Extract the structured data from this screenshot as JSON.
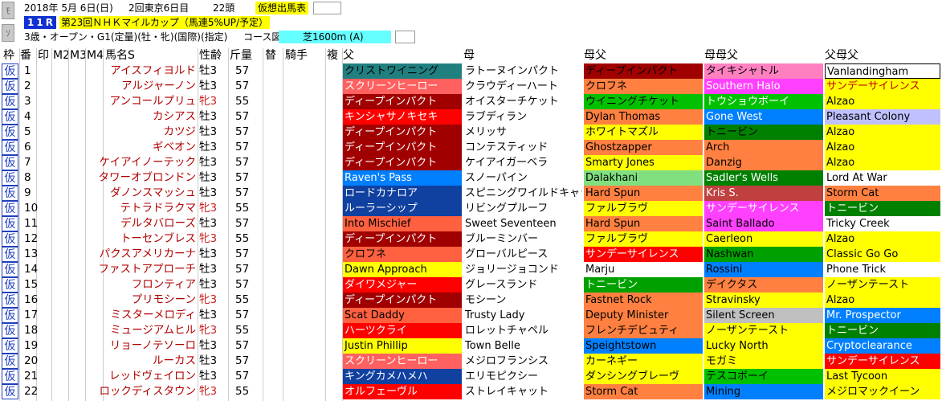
{
  "header": {
    "date": "2018年 5月 6日(日)",
    "meeting": "2回東京6日目",
    "count": "22頭",
    "card_type": "仮想出馬表",
    "race_no": "11R",
    "race_name": "第23回ＮＨＫマイルカップ（馬連5%UP/予定）",
    "conditions": "3歳・オープン・G1(定量)(牡・牝)(国際)(指定)",
    "course_label": "コース図",
    "course": "芝1600m (A)",
    "nav_up": "ﾓ",
    "nav_down": "ｿ"
  },
  "columns": [
    "枠",
    "番",
    "印",
    "M2",
    "M3",
    "M4",
    "馬名S",
    "性齢",
    "斤量",
    "替",
    "騎手",
    "複",
    "父",
    "母",
    "母父",
    "母母父",
    "父母父"
  ],
  "colors": {
    "accent": "#1030d0",
    "highlight": "#ffff00",
    "course": "#66ffff",
    "female": "#cc2020"
  },
  "rows": [
    {
      "waku": "仮",
      "num": "1",
      "name": "アイスフィヨルド",
      "sex": "牡3",
      "wt": "57",
      "sire": "クリストワイニング",
      "dam": "ラトーヌインパクト",
      "damsire": "ディープインパクト",
      "dd_sire": "タイキシャトル",
      "sire_sire": "Vanlandingham",
      "c": [
        "#208080",
        "#fff",
        "#a00000",
        "#ff80c0",
        "#fff"
      ],
      "t": [
        "#000",
        "#000",
        "#000",
        "#000",
        "#000"
      ]
    },
    {
      "waku": "仮",
      "num": "2",
      "name": "アルジャーノン",
      "sex": "牡3",
      "wt": "57",
      "sire": "スクリーンヒーロー",
      "dam": "クラウディーハート",
      "damsire": "クロフネ",
      "dd_sire": "Southern Halo",
      "sire_sire": "サンデーサイレンス",
      "c": [
        "#ff6060",
        "#fff",
        "#ff8040",
        "#ff40ff",
        "#ffff00"
      ],
      "t": [
        "#fff",
        "#000",
        "#000",
        "#fff",
        "#c00000"
      ]
    },
    {
      "waku": "仮",
      "num": "3",
      "name": "アンコールプリュ",
      "sex": "牝3",
      "wt": "55",
      "sire": "ディープインパクト",
      "dam": "オイスターチケット",
      "damsire": "ウイニングチケット",
      "dd_sire": "トウショウボーイ",
      "sire_sire": "Alzao",
      "c": [
        "#a00000",
        "#fff",
        "#00c000",
        "#00c000",
        "#ffff00"
      ],
      "t": [
        "#fff",
        "#000",
        "#000",
        "#fff",
        "#000"
      ]
    },
    {
      "waku": "仮",
      "num": "4",
      "name": "カシアス",
      "sex": "牡3",
      "wt": "57",
      "sire": "キンシャサノキセキ",
      "dam": "ラブディラン",
      "damsire": "Dylan Thomas",
      "dd_sire": "Gone West",
      "sire_sire": "Pleasant Colony",
      "c": [
        "#ff0000",
        "#fff",
        "#ff8040",
        "#0080ff",
        "#c0c0ff"
      ],
      "t": [
        "#fff",
        "#000",
        "#000",
        "#fff",
        "#000"
      ]
    },
    {
      "waku": "仮",
      "num": "5",
      "name": "カツジ",
      "sex": "牡3",
      "wt": "57",
      "sire": "ディープインパクト",
      "dam": "メリッサ",
      "damsire": "ホワイトマズル",
      "dd_sire": "トニービン",
      "sire_sire": "Alzao",
      "c": [
        "#a00000",
        "#fff",
        "#ffff00",
        "#008000",
        "#ffff00"
      ],
      "t": [
        "#fff",
        "#000",
        "#000",
        "#000",
        "#000"
      ]
    },
    {
      "waku": "仮",
      "num": "6",
      "name": "ギベオン",
      "sex": "牡3",
      "wt": "57",
      "sire": "ディープインパクト",
      "dam": "コンテスティッド",
      "damsire": "Ghostzapper",
      "dd_sire": "Arch",
      "sire_sire": "Alzao",
      "c": [
        "#a00000",
        "#fff",
        "#ff8040",
        "#ff8040",
        "#ffff00"
      ],
      "t": [
        "#fff",
        "#000",
        "#000",
        "#000",
        "#000"
      ]
    },
    {
      "waku": "仮",
      "num": "7",
      "name": "ケイアイノーテック",
      "sex": "牡3",
      "wt": "57",
      "sire": "ディープインパクト",
      "dam": "ケイアイガーベラ",
      "damsire": "Smarty Jones",
      "dd_sire": "Danzig",
      "sire_sire": "Alzao",
      "c": [
        "#a00000",
        "#fff",
        "#ffff00",
        "#ff8040",
        "#ffff00"
      ],
      "t": [
        "#fff",
        "#000",
        "#000",
        "#000",
        "#000"
      ]
    },
    {
      "waku": "仮",
      "num": "8",
      "name": "タワーオブロンドン",
      "sex": "牡3",
      "wt": "57",
      "sire": "Raven's Pass",
      "dam": "スノーパイン",
      "damsire": "Dalakhani",
      "dd_sire": "Sadler's Wells",
      "sire_sire": "Lord At War",
      "c": [
        "#0080ff",
        "#fff",
        "#80e080",
        "#008000",
        "#fff"
      ],
      "t": [
        "#fff",
        "#000",
        "#000",
        "#fff",
        "#000"
      ]
    },
    {
      "waku": "仮",
      "num": "9",
      "name": "ダノンスマッシュ",
      "sex": "牡3",
      "wt": "57",
      "sire": "ロードカナロア",
      "dam": "スピニングワイルドキャット",
      "damsire": "Hard Spun",
      "dd_sire": "Kris S.",
      "sire_sire": "Storm Cat",
      "c": [
        "#1040a0",
        "#fff",
        "#ff8040",
        "#c04040",
        "#ff8040"
      ],
      "t": [
        "#fff",
        "#000",
        "#000",
        "#fff",
        "#000"
      ]
    },
    {
      "waku": "仮",
      "num": "10",
      "name": "テトラドラクマ",
      "sex": "牝3",
      "wt": "55",
      "sire": "ルーラーシップ",
      "dam": "リビングプルーフ",
      "damsire": "ファルブラヴ",
      "dd_sire": "サンデーサイレンス",
      "sire_sire": "トニービン",
      "c": [
        "#1040a0",
        "#fff",
        "#ffff00",
        "#ff40ff",
        "#008000"
      ],
      "t": [
        "#fff",
        "#000",
        "#000",
        "#fff",
        "#fff"
      ]
    },
    {
      "waku": "仮",
      "num": "11",
      "name": "デルタバローズ",
      "sex": "牡3",
      "wt": "57",
      "sire": "Into Mischief",
      "dam": "Sweet Seventeen",
      "damsire": "Hard Spun",
      "dd_sire": "Saint Ballado",
      "sire_sire": "Tricky Creek",
      "c": [
        "#ff6040",
        "#fff",
        "#ff8040",
        "#ff40ff",
        "#fff"
      ],
      "t": [
        "#000",
        "#000",
        "#000",
        "#000",
        "#000"
      ]
    },
    {
      "waku": "仮",
      "num": "12",
      "name": "トーセンブレス",
      "sex": "牝3",
      "wt": "55",
      "sire": "ディープインパクト",
      "dam": "ブルーミンバー",
      "damsire": "ファルブラヴ",
      "dd_sire": "Caerleon",
      "sire_sire": "Alzao",
      "c": [
        "#a00000",
        "#fff",
        "#ffff00",
        "#ffff00",
        "#ffff00"
      ],
      "t": [
        "#fff",
        "#000",
        "#000",
        "#000",
        "#000"
      ]
    },
    {
      "waku": "仮",
      "num": "13",
      "name": "パクスアメリカーナ",
      "sex": "牡3",
      "wt": "57",
      "sire": "クロフネ",
      "dam": "グローバルピース",
      "damsire": "サンデーサイレンス",
      "dd_sire": "Nashwan",
      "sire_sire": "Classic Go Go",
      "c": [
        "#ff6040",
        "#fff",
        "#ff0000",
        "#00a000",
        "#ffff00"
      ],
      "t": [
        "#000",
        "#000",
        "#fff",
        "#000",
        "#000"
      ]
    },
    {
      "waku": "仮",
      "num": "14",
      "name": "ファストアプローチ",
      "sex": "牡3",
      "wt": "57",
      "sire": "Dawn Approach",
      "dam": "ジョリージョコンド",
      "damsire": "Marju",
      "dd_sire": "Rossini",
      "sire_sire": "Phone Trick",
      "c": [
        "#ffff00",
        "#fff",
        "#fff",
        "#0080ff",
        "#fff"
      ],
      "t": [
        "#000",
        "#000",
        "#000",
        "#000",
        "#000"
      ]
    },
    {
      "waku": "仮",
      "num": "15",
      "name": "フロンティア",
      "sex": "牡3",
      "wt": "57",
      "sire": "ダイワメジャー",
      "dam": "グレースランド",
      "damsire": "トニービン",
      "dd_sire": "デイクタス",
      "sire_sire": "ノーザンテースト",
      "c": [
        "#ff0000",
        "#fff",
        "#00a000",
        "#ff8040",
        "#ffff00"
      ],
      "t": [
        "#fff",
        "#000",
        "#fff",
        "#000",
        "#000"
      ]
    },
    {
      "waku": "仮",
      "num": "16",
      "name": "プリモシーン",
      "sex": "牝3",
      "wt": "55",
      "sire": "ディープインパクト",
      "dam": "モシーン",
      "damsire": "Fastnet Rock",
      "dd_sire": "Stravinsky",
      "sire_sire": "Alzao",
      "c": [
        "#a00000",
        "#fff",
        "#ff8040",
        "#ffff00",
        "#ffff00"
      ],
      "t": [
        "#fff",
        "#000",
        "#000",
        "#000",
        "#000"
      ]
    },
    {
      "waku": "仮",
      "num": "17",
      "name": "ミスターメロディ",
      "sex": "牡3",
      "wt": "57",
      "sire": "Scat Daddy",
      "dam": "Trusty Lady",
      "damsire": "Deputy Minister",
      "dd_sire": "Silent Screen",
      "sire_sire": "Mr. Prospector",
      "c": [
        "#ff6040",
        "#fff",
        "#ff8040",
        "#c0c0c0",
        "#0080ff"
      ],
      "t": [
        "#000",
        "#000",
        "#000",
        "#000",
        "#fff"
      ]
    },
    {
      "waku": "仮",
      "num": "18",
      "name": "ミュージアムヒル",
      "sex": "牝3",
      "wt": "55",
      "sire": "ハーツクライ",
      "dam": "ロレットチャペル",
      "damsire": "フレンチデピュティ",
      "dd_sire": "ノーザンテースト",
      "sire_sire": "トニービン",
      "c": [
        "#ff0000",
        "#fff",
        "#ff8040",
        "#ffff00",
        "#008000"
      ],
      "t": [
        "#fff",
        "#000",
        "#000",
        "#000",
        "#fff"
      ]
    },
    {
      "waku": "仮",
      "num": "19",
      "name": "リョーノテソーロ",
      "sex": "牡3",
      "wt": "57",
      "sire": "Justin Phillip",
      "dam": "Town Belle",
      "damsire": "Speightstown",
      "dd_sire": "Lucky North",
      "sire_sire": "Cryptoclearance",
      "c": [
        "#ffff00",
        "#fff",
        "#0080ff",
        "#ffff00",
        "#0080ff"
      ],
      "t": [
        "#000",
        "#000",
        "#000",
        "#000",
        "#fff"
      ]
    },
    {
      "waku": "仮",
      "num": "20",
      "name": "ルーカス",
      "sex": "牡3",
      "wt": "57",
      "sire": "スクリーンヒーロー",
      "dam": "メジロフランシス",
      "damsire": "カーネギー",
      "dd_sire": "モガミ",
      "sire_sire": "サンデーサイレンス",
      "c": [
        "#ff6060",
        "#fff",
        "#ffff00",
        "#ffff00",
        "#ff0000"
      ],
      "t": [
        "#fff",
        "#000",
        "#000",
        "#000",
        "#fff"
      ]
    },
    {
      "waku": "仮",
      "num": "21",
      "name": "レッドヴェイロン",
      "sex": "牡3",
      "wt": "57",
      "sire": "キングカメハメハ",
      "dam": "エリモピクシー",
      "damsire": "ダンシングブレーヴ",
      "dd_sire": "テスコボーイ",
      "sire_sire": "Last Tycoon",
      "c": [
        "#1040a0",
        "#fff",
        "#ffff00",
        "#00c000",
        "#ffff00"
      ],
      "t": [
        "#fff",
        "#000",
        "#000",
        "#000",
        "#000"
      ]
    },
    {
      "waku": "仮",
      "num": "22",
      "name": "ロックディスタウン",
      "sex": "牝3",
      "wt": "55",
      "sire": "オルフェーヴル",
      "dam": "ストレイキャット",
      "damsire": "Storm Cat",
      "dd_sire": "Mining",
      "sire_sire": "メジロマックイーン",
      "c": [
        "#ff0000",
        "#fff",
        "#ff8040",
        "#0080ff",
        "#ffff00"
      ],
      "t": [
        "#fff",
        "#000",
        "#000",
        "#000",
        "#000"
      ]
    }
  ]
}
